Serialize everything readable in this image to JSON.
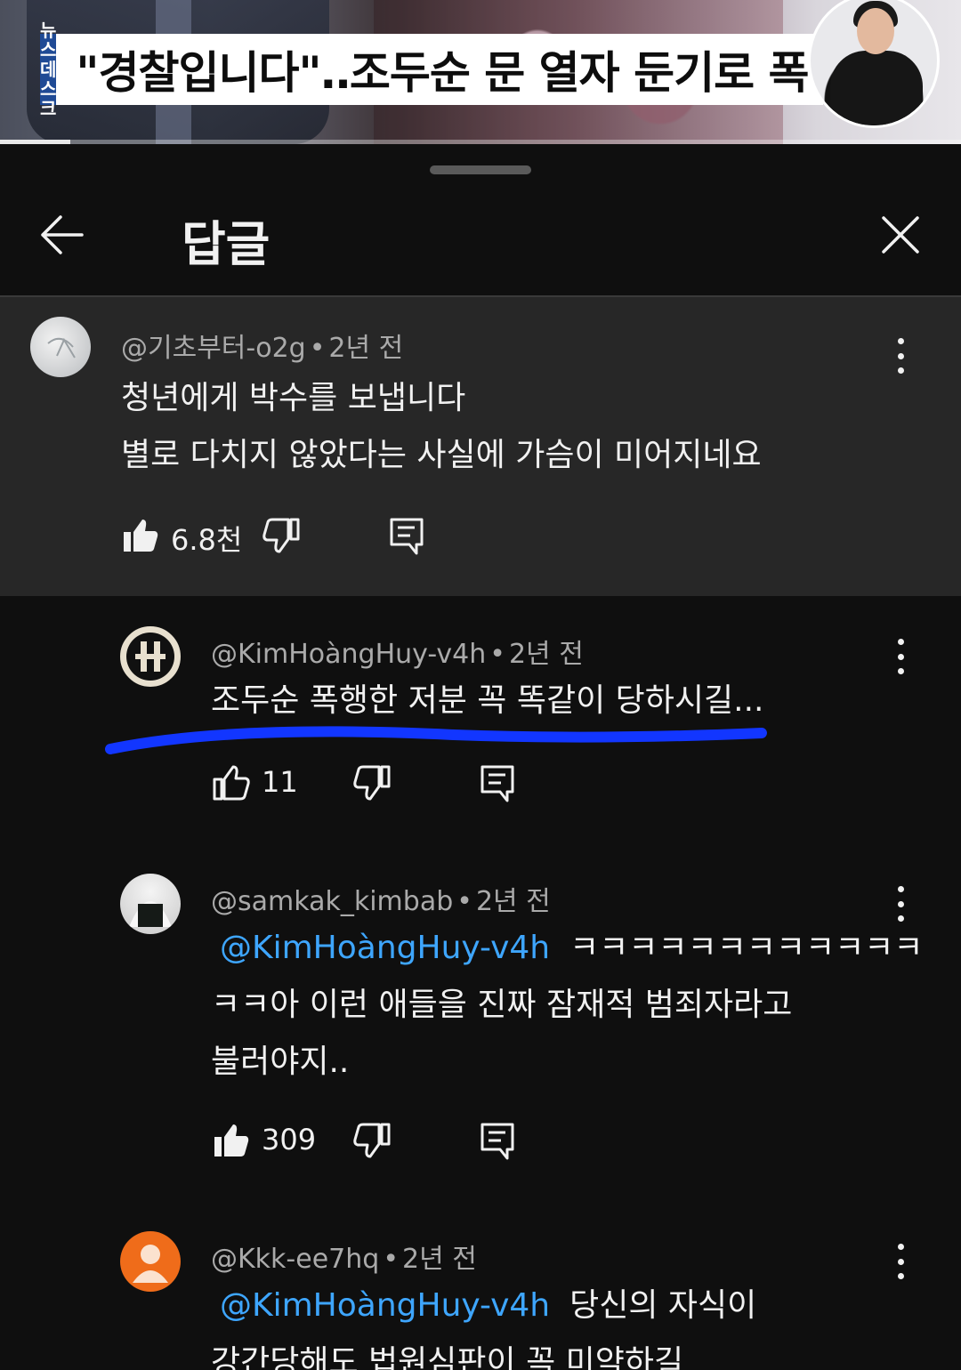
{
  "video": {
    "logo_line1": "뉴스",
    "logo_line2": "데스크",
    "headline": "\"경찰입니다\"‥조두순 문 열자 둔기로 폭행",
    "progress_fraction": 0.073
  },
  "sheet": {
    "title": "답글"
  },
  "comments": [
    {
      "author": "@기초부터-o2g",
      "time": "2년 전",
      "lines": [
        "청년에게 박수를 보냅니다",
        "별로 다치지 않았다는 사실에 가슴이 미어지네요"
      ],
      "likes": "6.8천",
      "liked": true
    },
    {
      "author": "@KimHoàngHuy-v4h",
      "time": "2년 전",
      "lines": [
        "조두순 폭행한 저분 꼭 똑같이 당하시길..."
      ],
      "likes": "11",
      "liked": false,
      "underline_color": "#1236ff"
    },
    {
      "author": "@samkak_kimbab",
      "time": "2년 전",
      "mention": "@KimHoàngHuy-v4h",
      "line1_rest": "ㅋㅋㅋㅋㅋㅋㅋㅋㅋㅋㅋㅋ",
      "lines": [
        "ㅋㅋ아 이런 애들을 진짜 잠재적 범죄자라고",
        "불러야지.."
      ],
      "likes": "309",
      "liked": true
    },
    {
      "author": "@Kkk-ee7hq",
      "time": "2년 전",
      "mention": "@KimHoàngHuy-v4h",
      "line1_rest": "당신의 자식이",
      "lines": [
        "강간당해도 법원심판이 꼭 미약하길"
      ],
      "avatar_color": "#ef6c1a"
    }
  ],
  "colors": {
    "background": "#0f0f0f",
    "highlight_background": "#272727",
    "mention": "#3ea6ff",
    "meta_text": "#aaaaaa"
  }
}
